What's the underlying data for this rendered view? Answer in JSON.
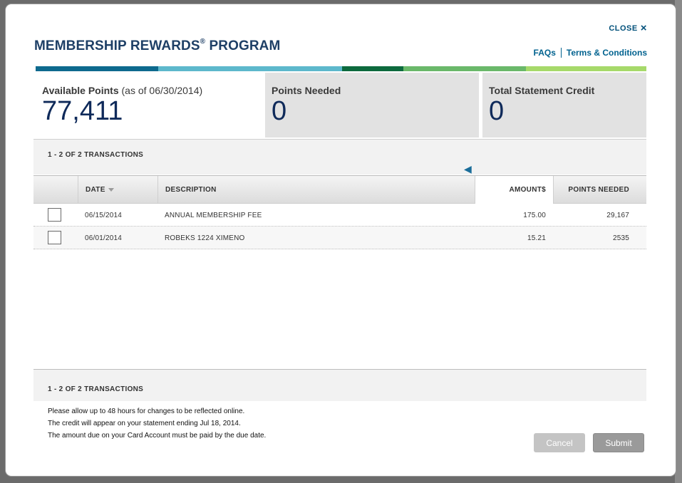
{
  "modal": {
    "title": "MEMBERSHIP REWARDS",
    "title_mark": "®",
    "title_suffix": " PROGRAM",
    "close_label": "CLOSE",
    "close_icon": "×",
    "links": {
      "faqs": "FAQs",
      "terms": "Terms & Conditions"
    }
  },
  "color_bar": [
    "#0e6a8e",
    "#5db8cc",
    "#0d6a3e",
    "#6ab86a",
    "#a6d96a"
  ],
  "stats": {
    "available": {
      "label": "Available Points",
      "sub": "(as of 06/30/2014)",
      "value": "77,411"
    },
    "needed": {
      "label": "Points Needed",
      "value": "0"
    },
    "credit": {
      "label": "Total Statement Credit",
      "value": "0"
    }
  },
  "range_top": "1 - 2 OF 2 TRANSACTIONS",
  "range_bottom": "1 - 2 OF 2 TRANSACTIONS",
  "scroll_icon": "◀",
  "table": {
    "headers": {
      "date": "DATE",
      "description": "DESCRIPTION",
      "amount": "AMOUNT$",
      "points": "POINTS NEEDED"
    },
    "rows": [
      {
        "date": "06/15/2014",
        "description": "ANNUAL MEMBERSHIP FEE",
        "amount": "175.00",
        "points": "29,167"
      },
      {
        "date": "06/01/2014",
        "description": "ROBEKS 1224 XIMENO",
        "amount": "15.21",
        "points": "2535"
      }
    ]
  },
  "notes": [
    "Please allow up to 48 hours for changes to be reflected online.",
    "The credit will appear on your statement ending Jul 18, 2014.",
    "The amount due on your Card Account must be paid by the due date."
  ],
  "buttons": {
    "cancel": "Cancel",
    "submit": "Submit"
  }
}
